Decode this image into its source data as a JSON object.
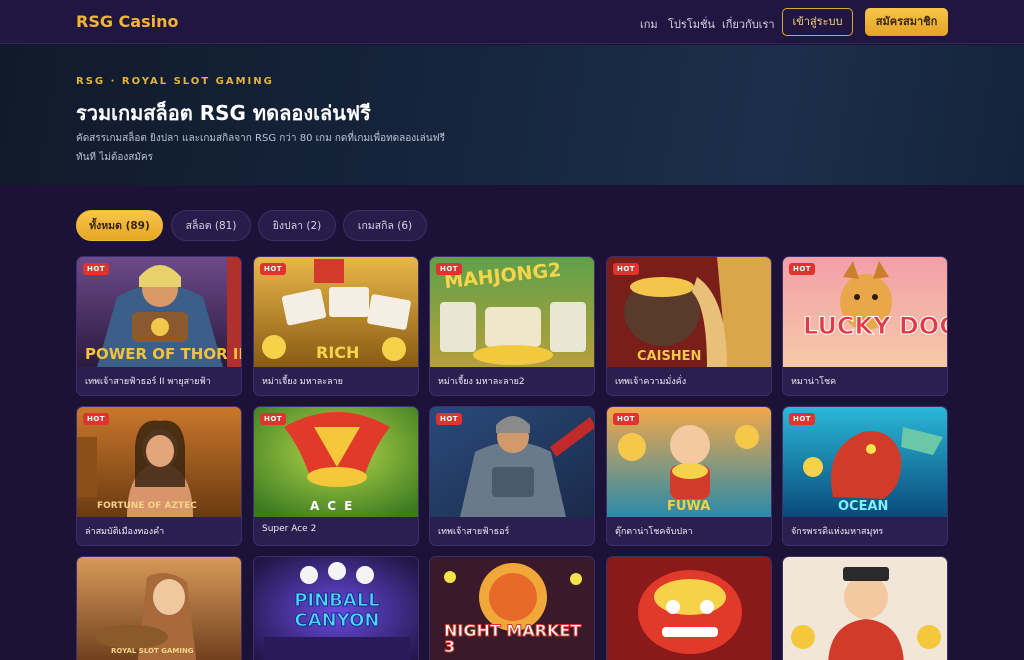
{
  "brand": "RSG Casino",
  "nav": {
    "games": "เกม",
    "promotions": "โปรโมชั่น",
    "about": "เกี่ยวกับเรา"
  },
  "auth": {
    "login": "เข้าสู่ระบบ",
    "register": "สมัครสมาชิก"
  },
  "hero": {
    "kicker": "RSG · ROYAL SLOT GAMING",
    "title": "รวมเกมสล็อต RSG ทดลองเล่นฟรี",
    "subtitle": "คัดสรรเกมสล็อต ยิงปลา และเกมสกิลจาก RSG กว่า 80 เกม กดที่เกมเพื่อทดลองเล่นฟรี ทันที ไม่ต้องสมัคร"
  },
  "filters": [
    {
      "label": "ทั้งหมด (89)",
      "active": true
    },
    {
      "label": "สล็อต (81)",
      "active": false
    },
    {
      "label": "ยิงปลา (2)",
      "active": false
    },
    {
      "label": "เกมสกิล (6)",
      "active": false
    }
  ],
  "hot_label": "HOT",
  "games": [
    {
      "name": "เทพเจ้าสายฟ้าธอร์ II พายุสายฟ้า",
      "hot": true,
      "art": "POWER OF THOR II"
    },
    {
      "name": "หม่าเจี้ยง มหาละลาย",
      "hot": true,
      "art": "RICH"
    },
    {
      "name": "หม่าเจี้ยง มหาละลาย2",
      "hot": true,
      "art": "MAHJONG2"
    },
    {
      "name": "เทพเจ้าความมั่งคั่ง",
      "hot": true,
      "art": "CAISHEN"
    },
    {
      "name": "หมาน่าโชค",
      "hot": true,
      "art": "LUCKY DOG"
    },
    {
      "name": "ล่าสมบัติเมืองทองคำ",
      "hot": true,
      "art": "FORTUNE OF AZTEC"
    },
    {
      "name": "Super Ace 2",
      "hot": true,
      "art": "ACE"
    },
    {
      "name": "เทพเจ้าสายฟ้าธอร์",
      "hot": true,
      "art": ""
    },
    {
      "name": "ตุ๊กตาน่าโชคจับปลา",
      "hot": true,
      "art": "FUWA"
    },
    {
      "name": "จักรพรรดิแห่งมหาสมุทร",
      "hot": true,
      "art": "OCEAN"
    },
    {
      "name": "",
      "hot": false,
      "art": "ROYAL SLOT GAMING"
    },
    {
      "name": "",
      "hot": false,
      "art": "PINBALL CANYON"
    },
    {
      "name": "",
      "hot": false,
      "art": "NIGHT MARKET 3"
    },
    {
      "name": "",
      "hot": false,
      "art": ""
    },
    {
      "name": "",
      "hot": false,
      "art": ""
    }
  ],
  "colors": {
    "accent": "#f2b632",
    "background": "#1c1238",
    "hot_badge": "#e0322e"
  }
}
